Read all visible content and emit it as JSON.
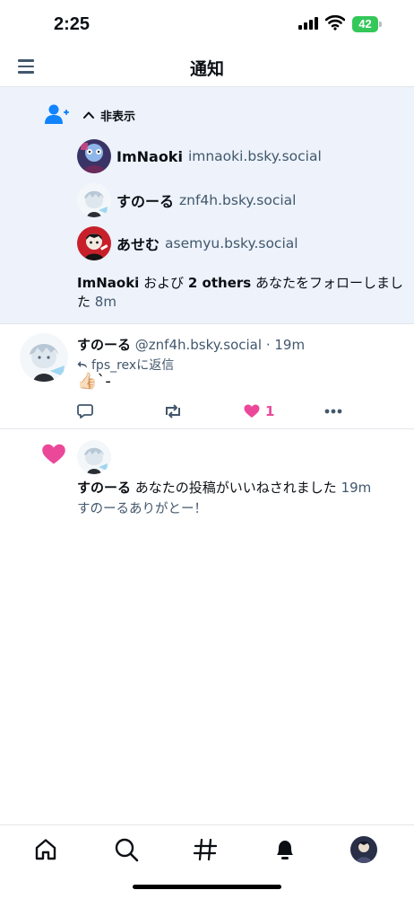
{
  "status_bar": {
    "time": "2:25",
    "battery": "42"
  },
  "header": {
    "title": "通知"
  },
  "follow_group": {
    "toggle_label": "非表示",
    "users": [
      {
        "name": "ImNaoki",
        "handle": "imnaoki.bsky.social"
      },
      {
        "name": "すのーる",
        "handle": "znf4h.bsky.social"
      },
      {
        "name": "あせむ",
        "handle": "asemyu.bsky.social"
      }
    ],
    "summary": {
      "name": "ImNaoki",
      "connector": "および",
      "others": "2 others",
      "action": "あなたをフォローしました",
      "time": "8m"
    }
  },
  "reply": {
    "name": "すのーる",
    "handle": "@znf4h.bsky.social",
    "separator": "·",
    "time": "19m",
    "reply_to": "fps_rexに返信",
    "body": "👍🏻`-",
    "like_count": "1"
  },
  "like_notification": {
    "name": "すのーる",
    "action": "あなたの投稿がいいねされました",
    "time": "19m",
    "post_text": "すのーるありがとー！"
  },
  "colors": {
    "accent": "#1083fe",
    "like": "#ec4899",
    "follow_bg": "#edf2fb",
    "muted": "#42576c"
  },
  "icons": {
    "menu": "menu-icon",
    "person_add": "person-add-icon",
    "chevron": "chevron-up-icon",
    "reply": "comment-icon",
    "repost": "repost-icon",
    "like": "heart-icon",
    "more": "ellipsis-icon",
    "tabs": [
      "home-icon",
      "search-icon",
      "hashtag-icon",
      "bell-icon",
      "avatar"
    ]
  }
}
